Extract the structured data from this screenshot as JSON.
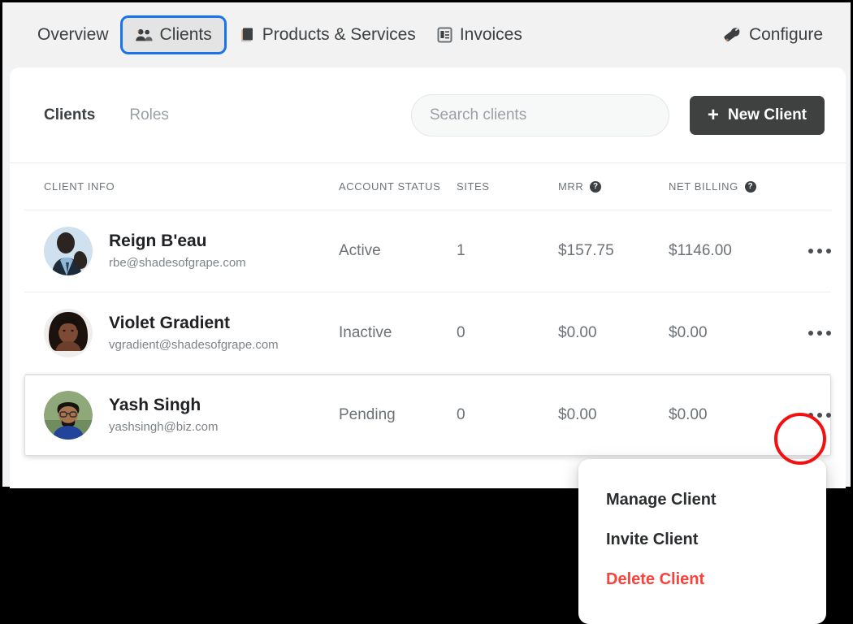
{
  "topnav": {
    "items": [
      {
        "label": "Overview",
        "icon": "",
        "active": false
      },
      {
        "label": "Clients",
        "icon": "users-icon",
        "active": true
      },
      {
        "label": "Products & Services",
        "icon": "box-icon",
        "active": false
      },
      {
        "label": "Invoices",
        "icon": "invoice-icon",
        "active": false
      }
    ],
    "configure_label": "Configure",
    "configure_icon": "wrench-icon",
    "active_tab_outline_color": "#1a73e8"
  },
  "card": {
    "tabs": [
      {
        "label": "Clients",
        "active": true
      },
      {
        "label": "Roles",
        "active": false
      }
    ],
    "search": {
      "placeholder": "Search clients",
      "value": ""
    },
    "new_client_button": {
      "label": "New Client",
      "icon": "plus-icon",
      "background": "#3f4040"
    }
  },
  "table": {
    "columns": [
      {
        "label": "Client Info",
        "help": false
      },
      {
        "label": "Account Status",
        "help": false
      },
      {
        "label": "Sites",
        "help": false
      },
      {
        "label": "MRR",
        "help": true
      },
      {
        "label": "Net Billing",
        "help": true
      },
      {
        "label": "",
        "help": false
      }
    ],
    "help_glyph": "?",
    "rows": [
      {
        "name": "Reign B'eau",
        "email": "rbe@shadesofgrape.com",
        "status": "Active",
        "sites": "1",
        "mrr": "$157.75",
        "net_billing": "$1146.00",
        "avatar": "photo-man-suit",
        "selected": false
      },
      {
        "name": "Violet Gradient",
        "email": "vgradient@shadesofgrape.com",
        "status": "Inactive",
        "sites": "0",
        "mrr": "$0.00",
        "net_billing": "$0.00",
        "avatar": "photo-woman-curly",
        "selected": false
      },
      {
        "name": "Yash Singh",
        "email": "yashsingh@biz.com",
        "status": "Pending",
        "sites": "0",
        "mrr": "$0.00",
        "net_billing": "$0.00",
        "avatar": "photo-man-glasses",
        "selected": true
      }
    ]
  },
  "context_menu": {
    "items": [
      {
        "label": "Manage Client",
        "danger": false
      },
      {
        "label": "Invite Client",
        "danger": false
      },
      {
        "label": "Delete Client",
        "danger": true
      }
    ],
    "danger_color": "#f9423a"
  },
  "annotation": {
    "highlight_shape": "circle",
    "highlight_color": "#f31010",
    "target": "row-kebab-menu-yash-singh"
  }
}
